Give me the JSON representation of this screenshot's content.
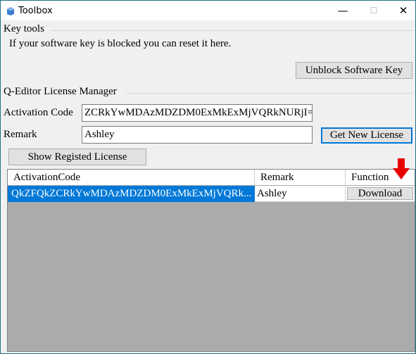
{
  "window": {
    "title": "Toolbox",
    "minimize_glyph": "—",
    "maximize_glyph": "☐",
    "close_glyph": "✕"
  },
  "key_tools": {
    "group_label": "Key tools",
    "description": "If your software key is blocked you can reset it here.",
    "unblock_button": "Unblock Software Key"
  },
  "license_manager": {
    "group_label": "Q-Editor License Manager",
    "activation_label": "Activation Code",
    "activation_value": "ZCRkYwMDAzMDZDM0ExMkExMjVQRkNURjI=",
    "remark_label": "Remark",
    "remark_value": "Ashley",
    "get_license_button": "Get New License",
    "show_license_button": "Show Registed License"
  },
  "grid": {
    "columns": [
      "ActivationCode",
      "Remark",
      "Function"
    ],
    "rows": [
      {
        "activation_code": "QkZFQkZCRkYwMDAzMDZDM0ExMkExMjVQRk...",
        "remark": "Ashley",
        "function": "Download"
      }
    ]
  },
  "colors": {
    "selection": "#0078d7",
    "grid_background": "#ababab",
    "arrow": "#e60000"
  }
}
